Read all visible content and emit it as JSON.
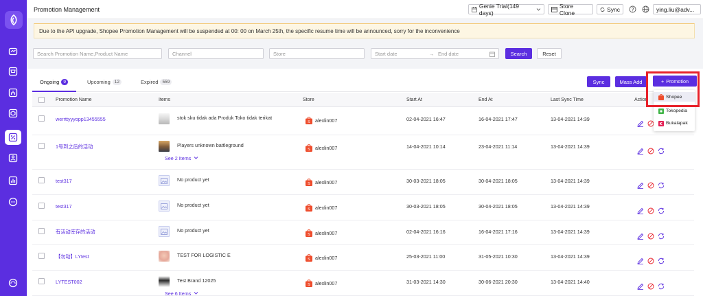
{
  "header": {
    "title": "Promotion Management",
    "plan_label": "Genie Trial(149 days)",
    "store_clone_label": "Store Clone",
    "sync_label": "Sync",
    "user_label": "ying.liu@adv..."
  },
  "banner": {
    "text": "Due to the API upgrade, Shopee Promotion Management will be suspended at 00: 00 on March 25th, the specific resume time will be announced, sorry for the inconvenience"
  },
  "filters": {
    "search_placeholder": "Search Promotion Name,Product Name",
    "channel_placeholder": "Channel",
    "store_placeholder": "Store",
    "start_date_placeholder": "Start date",
    "date_separator": "→",
    "end_date_placeholder": "End date",
    "search_label": "Search",
    "reset_label": "Reset"
  },
  "tabs": [
    {
      "label": "Ongoing",
      "count": "9"
    },
    {
      "label": "Upcoming",
      "count": "12"
    },
    {
      "label": "Expired",
      "count": "559"
    }
  ],
  "toolbar": {
    "sync_label": "Sync",
    "mass_add_label": "Mass Add",
    "promotion_label": "Promotion"
  },
  "channel_menu": [
    {
      "label": "Shopee",
      "color": "#ee4d2d"
    },
    {
      "label": "Tokopedia",
      "color": "#42b549"
    },
    {
      "label": "Bukalapak",
      "color": "#e31e52"
    }
  ],
  "table": {
    "columns": {
      "name": "Promotion Name",
      "items": "Items",
      "store": "Store",
      "start": "Start At",
      "end": "End At",
      "last_sync": "Last Sync Time",
      "action": "Action"
    },
    "rows": [
      {
        "name": "werrttyyyopp13455555",
        "item": "stok sku tidak ada Produk Toko tidak terikat",
        "see_items": "",
        "store": "alexlin007",
        "start": "02-04-2021 16:47",
        "end": "16-04-2021 17:47",
        "sync": "13-04-2021 14:39"
      },
      {
        "name": "1号到之后的活动",
        "item": "Players unknown battleground",
        "see_items": "See 2 Items",
        "store": "alexlin007",
        "start": "14-04-2021 10:14",
        "end": "23-04-2021 11:14",
        "sync": "13-04-2021 14:39"
      },
      {
        "name": "test317",
        "item": "No product yet",
        "see_items": "",
        "store": "alexlin007",
        "start": "30-03-2021 18:05",
        "end": "30-04-2021 18:05",
        "sync": "13-04-2021 14:39"
      },
      {
        "name": "test317",
        "item": "No product yet",
        "see_items": "",
        "store": "alexlin007",
        "start": "30-03-2021 18:05",
        "end": "30-04-2021 18:05",
        "sync": "13-04-2021 14:39"
      },
      {
        "name": "有活动库存的活动",
        "item": "No product yet",
        "see_items": "",
        "store": "alexlin007",
        "start": "02-04-2021 16:16",
        "end": "16-04-2021 17:16",
        "sync": "13-04-2021 14:39"
      },
      {
        "name": "【勿动】LYtest",
        "item": "TEST FOR LOGISTIC E",
        "see_items": "",
        "store": "alexlin007",
        "start": "25-03-2021 11:00",
        "end": "31-05-2021 10:30",
        "sync": "13-04-2021 14:39"
      },
      {
        "name": "LYTEST002",
        "item": "Test Brand 12025",
        "see_items": "See 6 Items",
        "store": "alexlin007",
        "start": "31-03-2021 14:30",
        "end": "30-06-2021 20:30",
        "sync": "13-04-2021 14:40"
      }
    ]
  },
  "colors": {
    "primary": "#5b2ee0",
    "highlight_box": "#e8212a",
    "banner_bg": "#fdf6e3"
  }
}
